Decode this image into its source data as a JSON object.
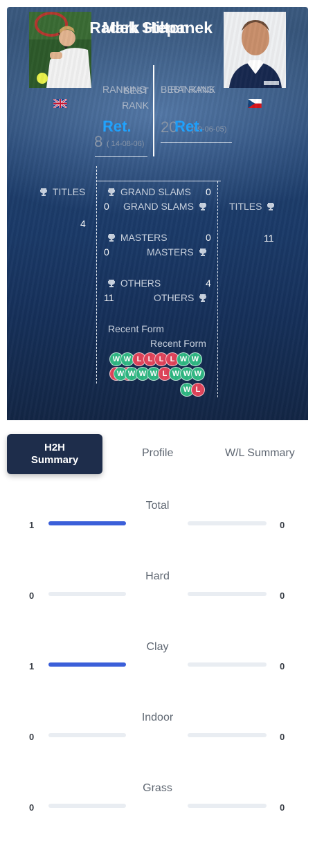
{
  "players": {
    "left": {
      "name": "Mark Hilton",
      "flag": "GB",
      "ranking_label": "RANKING",
      "best_rank_label": "BEST RANK",
      "ranking": "Ret.",
      "best_rank": "8",
      "best_rank_date": "( 14-08-06)"
    },
    "right": {
      "name": "Radek Stepanek",
      "flag": "CZ",
      "ranking_label": "RANKING",
      "best_rank_label": "BEST RANK",
      "ranking": "Ret.",
      "best_rank": "20",
      "best_rank_date": "(09-06-05)"
    }
  },
  "titles": {
    "label": "TITLES",
    "left_total": "4",
    "right_total": "11",
    "grand_slams": {
      "label": "GRAND SLAMS",
      "left": "0",
      "right": "0"
    },
    "masters": {
      "label": "MASTERS",
      "left": "0",
      "right": "0"
    },
    "others": {
      "label": "OTHERS",
      "left": "4",
      "right": "11"
    }
  },
  "recent_form": {
    "label": "Recent Form",
    "left": [
      "W",
      "W",
      "L",
      "L",
      "L",
      "L",
      "W",
      "W",
      "L",
      "L"
    ],
    "right": [
      "W",
      "W",
      "W",
      "W",
      "L",
      "W",
      "W",
      "W",
      "W",
      "L"
    ]
  },
  "tabs": {
    "h2h": "H2H Summary",
    "profile": "Profile",
    "wl": "W/L Summary"
  },
  "stats": [
    {
      "label": "Total",
      "left": "1",
      "right": "0",
      "left_frac": 1,
      "right_frac": 0
    },
    {
      "label": "Hard",
      "left": "0",
      "right": "0",
      "left_frac": 0,
      "right_frac": 0
    },
    {
      "label": "Clay",
      "left": "1",
      "right": "0",
      "left_frac": 1,
      "right_frac": 0
    },
    {
      "label": "Indoor",
      "left": "0",
      "right": "0",
      "left_frac": 0,
      "right_frac": 0
    },
    {
      "label": "Grass",
      "left": "0",
      "right": "0",
      "left_frac": 0,
      "right_frac": 0
    }
  ],
  "colors": {
    "win": "#2fb883",
    "loss": "#e0435a",
    "bar": "#3b5fd9",
    "ret": "#1fa2ff",
    "tab_active": "#1e2d4b"
  }
}
